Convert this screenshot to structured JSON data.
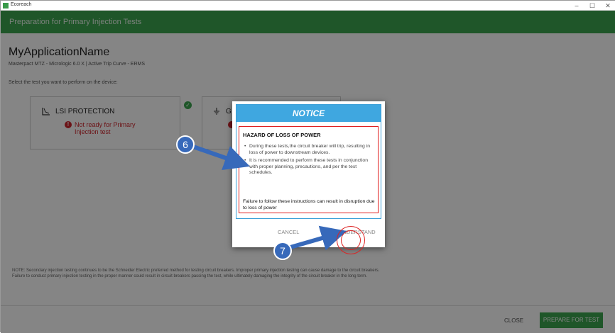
{
  "window": {
    "title": "Ecoreach",
    "minimize": "–",
    "maximize": "☐",
    "close": "✕"
  },
  "header": {
    "title": "Preparation for Primary Injection Tests"
  },
  "main": {
    "app_name": "MyApplicationName",
    "device_info": "Masterpact MTZ - Micrologic 6.0 X   |   Active Trip Curve  -  ERMS",
    "prompt": "Select the test you want to perform on the device:",
    "cards": [
      {
        "title": "LSI PROTECTION",
        "status": "Not ready for Primary Injection test",
        "icon": "lsi-curve-icon"
      },
      {
        "title": "G",
        "icon": "ground-icon"
      }
    ],
    "note": "NOTE: Secondary injection testing continues to be the Schneider Electric preferred method for testing circuit breakers. Improper primary injection testing can cause damage to the circuit breakers. Failure to conduct primary injection testing in the proper manner could result in circuit breakers passing the test, while ultimately damaging the integrity of the circuit breaker in the long term."
  },
  "footer": {
    "close_label": "CLOSE",
    "prepare_label": "PREPARE FOR TEST"
  },
  "dialog": {
    "title": "NOTICE",
    "hazard_heading": "HAZARD OF LOSS OF POWER",
    "bullets": [
      "During these tests,the circuit breaker will trip, resulting in loss of power to downstream devices.",
      "It is recommended to perform these tests in conjunction with proper planning, precautions, and per the test schedules."
    ],
    "failure_text": "Failure to follow these instructions can result in disruption due to loss of power",
    "cancel_label": "CANCEL",
    "understand_label": "I UNDERSTAND"
  },
  "annotations": {
    "step_6": "6",
    "step_7": "7",
    "arrow_color": "#3769ba",
    "highlight_color": "#d22222"
  },
  "colors": {
    "brand_green": "#3da64f",
    "notice_blue": "#3fa7e0",
    "danger_red": "#d0262d"
  }
}
